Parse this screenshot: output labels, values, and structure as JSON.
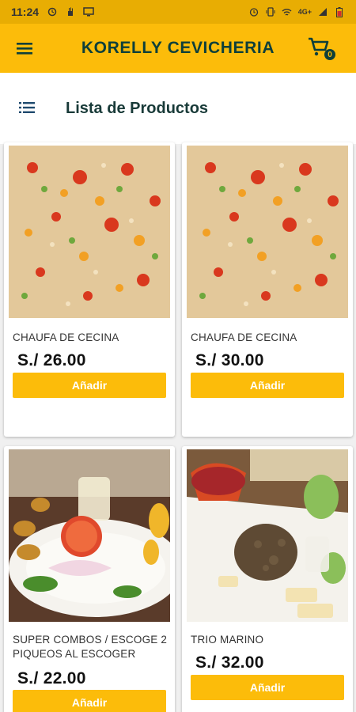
{
  "status_bar": {
    "time": "11:24",
    "network": "4G+"
  },
  "app_bar": {
    "title": "KORELLY CEVICHERIA",
    "cart_badge": "0"
  },
  "page": {
    "title": "Lista de Productos"
  },
  "products": [
    {
      "name": "CHAUFA DE CECINA",
      "price": "S./ 26.00",
      "button": "Añadir",
      "image": "fried-rice"
    },
    {
      "name": "CHAUFA DE CECINA",
      "price": "S./ 30.00",
      "button": "Añadir",
      "image": "fried-rice"
    },
    {
      "name": "SUPER COMBOS / ESCOGE  2 PIQUEOS AL ESCOGER",
      "price": "S./ 22.00",
      "button": "Añadir",
      "image": "ceviche-combo"
    },
    {
      "name": "TRIO MARINO",
      "price": "S./ 32.00",
      "button": "Añadir",
      "image": "trio-marino"
    }
  ],
  "colors": {
    "primary": "#fcbc0a",
    "status_bar": "#e8ad03",
    "title_text": "#0e3f3a"
  },
  "icons": [
    "menu-icon",
    "cart-icon",
    "list-icon",
    "alarm-icon",
    "signal-icon",
    "battery-icon",
    "wifi-icon"
  ]
}
